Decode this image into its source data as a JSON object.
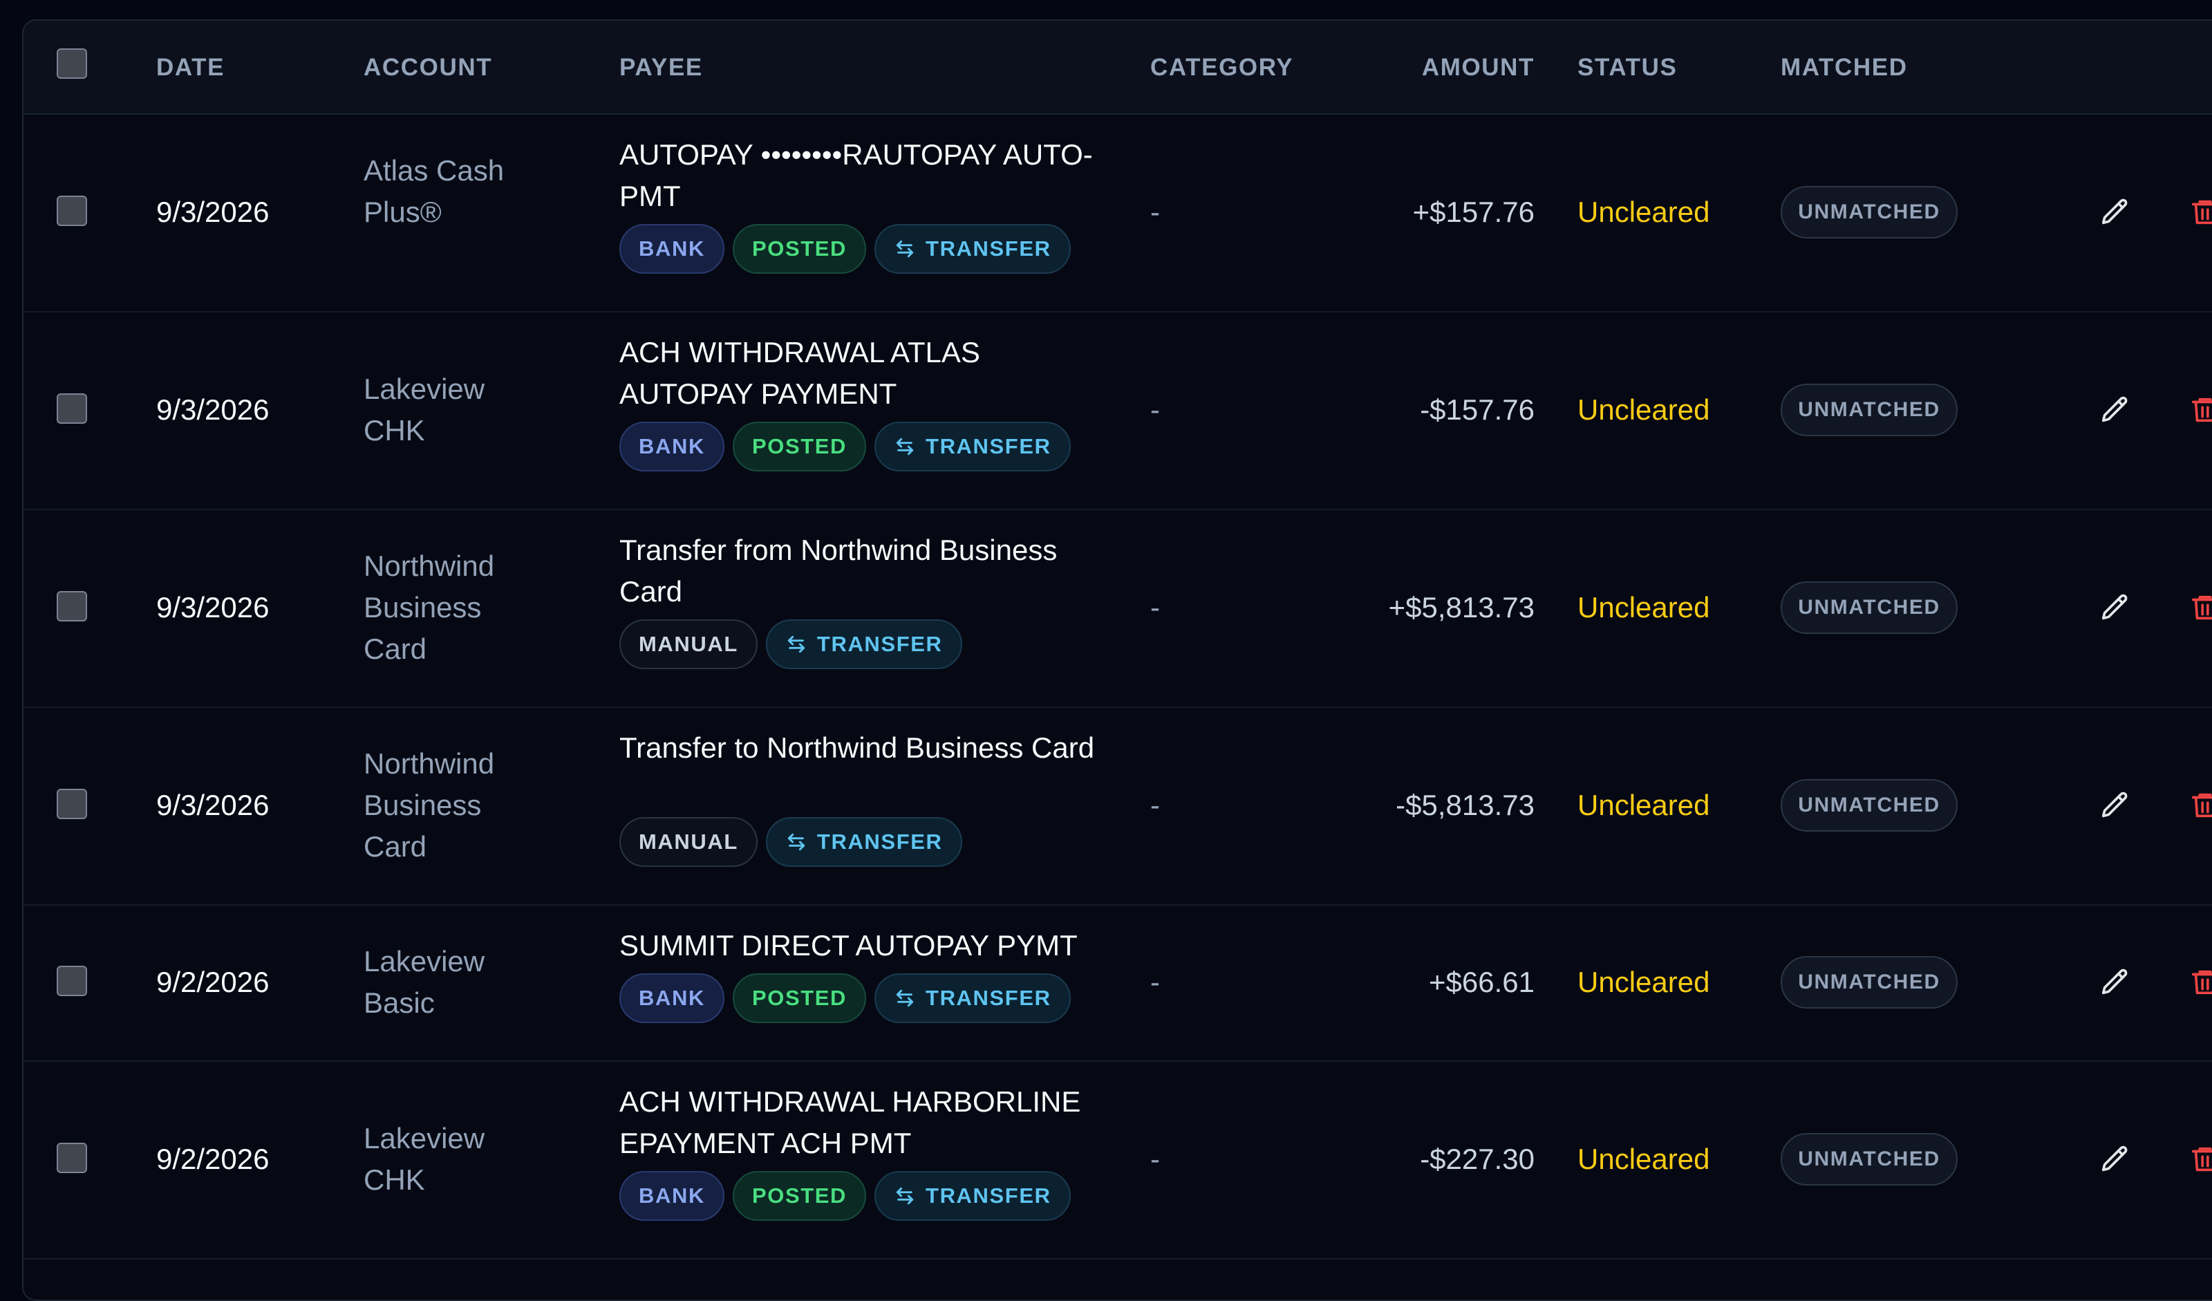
{
  "columns": {
    "date": "DATE",
    "account": "ACCOUNT",
    "payee": "PAYEE",
    "category": "CATEGORY",
    "amount": "AMOUNT",
    "status": "STATUS",
    "matched": "MATCHED"
  },
  "colors": {
    "status_uncleared": "#facc15",
    "delete_icon": "#ef4444",
    "edit_icon": "#e5e7eb"
  },
  "rows": [
    {
      "date": "9/3/2026",
      "account": "Atlas Cash Plus®",
      "payee": "AUTOPAY ••••••••RAUTOPAY AUTO-PMT",
      "tags": [
        {
          "kind": "bank",
          "label": "BANK"
        },
        {
          "kind": "posted",
          "label": "POSTED"
        },
        {
          "kind": "transfer",
          "label": "TRANSFER",
          "icon": "transfer-icon"
        }
      ],
      "category": "-",
      "amount": "+$157.76",
      "status": "Uncleared",
      "matched": "UNMATCHED"
    },
    {
      "date": "9/3/2026",
      "account": "Lakeview CHK",
      "payee": "ACH WITHDRAWAL ATLAS AUTOPAY PAYMENT",
      "tags": [
        {
          "kind": "bank",
          "label": "BANK"
        },
        {
          "kind": "posted",
          "label": "POSTED"
        },
        {
          "kind": "transfer",
          "label": "TRANSFER",
          "icon": "transfer-icon"
        }
      ],
      "category": "-",
      "amount": "-$157.76",
      "status": "Uncleared",
      "matched": "UNMATCHED"
    },
    {
      "date": "9/3/2026",
      "account": "Northwind Business Card",
      "payee": "Transfer from Northwind Business Card",
      "tags": [
        {
          "kind": "manual",
          "label": "MANUAL"
        },
        {
          "kind": "transfer",
          "label": "TRANSFER",
          "icon": "transfer-icon"
        }
      ],
      "category": "-",
      "amount": "+$5,813.73",
      "status": "Uncleared",
      "matched": "UNMATCHED"
    },
    {
      "date": "9/3/2026",
      "account": "Northwind Business Card",
      "payee": "Transfer to Northwind Business Card",
      "tags": [
        {
          "kind": "manual",
          "label": "MANUAL"
        },
        {
          "kind": "transfer",
          "label": "TRANSFER",
          "icon": "transfer-icon"
        }
      ],
      "category": "-",
      "amount": "-$5,813.73",
      "status": "Uncleared",
      "matched": "UNMATCHED"
    },
    {
      "date": "9/2/2026",
      "account": "Lakeview Basic",
      "payee": "SUMMIT DIRECT AUTOPAY PYMT",
      "tags": [
        {
          "kind": "bank",
          "label": "BANK"
        },
        {
          "kind": "posted",
          "label": "POSTED"
        },
        {
          "kind": "transfer",
          "label": "TRANSFER",
          "icon": "transfer-icon"
        }
      ],
      "category": "-",
      "amount": "+$66.61",
      "status": "Uncleared",
      "matched": "UNMATCHED"
    },
    {
      "date": "9/2/2026",
      "account": "Lakeview CHK",
      "payee": "ACH WITHDRAWAL HARBORLINE EPAYMENT ACH PMT",
      "tags": [
        {
          "kind": "bank",
          "label": "BANK"
        },
        {
          "kind": "posted",
          "label": "POSTED"
        },
        {
          "kind": "transfer",
          "label": "TRANSFER",
          "icon": "transfer-icon"
        }
      ],
      "category": "-",
      "amount": "-$227.30",
      "status": "Uncleared",
      "matched": "UNMATCHED"
    }
  ]
}
